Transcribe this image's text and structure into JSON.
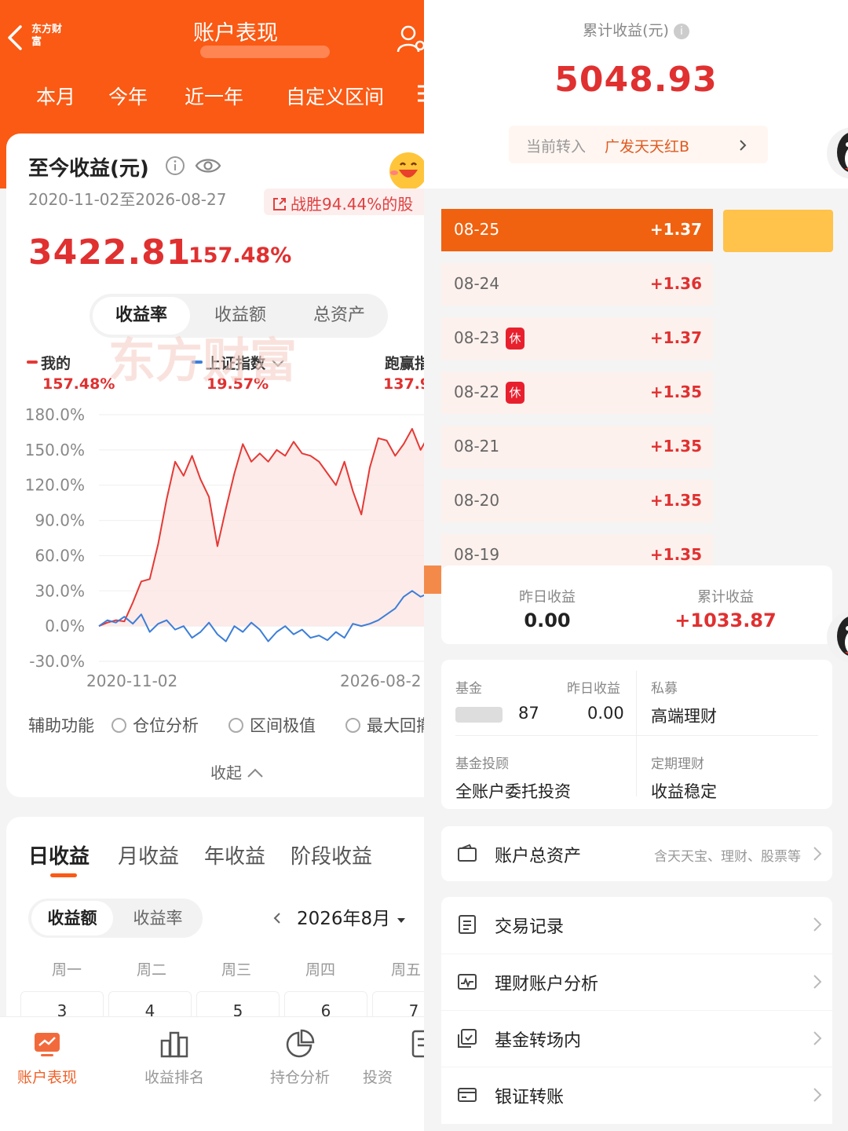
{
  "left": {
    "header": {
      "logo": "东方财富",
      "title": "账户表现",
      "periods": [
        "本月",
        "今年",
        "近一年",
        "自定义区间"
      ]
    },
    "summary": {
      "title": "至今收益(元)",
      "date_range": "2020-11-02至2026-08-27",
      "beat_text": "战胜94.44%的股",
      "profit": "3422.81",
      "rate": "157.48%"
    },
    "metric_tabs": [
      "收益率",
      "收益额",
      "总资产"
    ],
    "legend": {
      "mine_label": "我的",
      "mine_value": "157.48%",
      "index_label": "上证指数",
      "index_value": "19.57%",
      "outperform_label": "跑赢指",
      "outperform_value": "137.9"
    },
    "watermark": "东方财富",
    "aux": {
      "label": "辅助功能",
      "options": [
        "仓位分析",
        "区间极值",
        "最大回撤"
      ],
      "collapse": "收起"
    },
    "income_tabs": [
      "日收益",
      "月收益",
      "年收益",
      "阶段收益"
    ],
    "income_seg": [
      "收益额",
      "收益率"
    ],
    "month": "2026年8月",
    "weekdays": [
      "周一",
      "周二",
      "周三",
      "周四",
      "周五"
    ],
    "days": [
      "3",
      "4",
      "5",
      "6",
      "7"
    ],
    "bottom_nav": [
      "账户表现",
      "收益排名",
      "持仓分析",
      "投资"
    ]
  },
  "chart_data": {
    "type": "line",
    "title": "",
    "xlabel": "",
    "ylabel": "",
    "ylim": [
      -30,
      180
    ],
    "yticks": [
      "180.0%",
      "150.0%",
      "120.0%",
      "90.0%",
      "60.0%",
      "30.0%",
      "0.0%",
      "-30.0%"
    ],
    "xticks": [
      "2020-11-02",
      "2026-08-2"
    ],
    "colors": {
      "mine": "#e53935",
      "index": "#3d7ed8"
    },
    "series": [
      {
        "name": "我的",
        "values": [
          0,
          3,
          5,
          4,
          20,
          38,
          40,
          70,
          108,
          140,
          128,
          145,
          125,
          110,
          68,
          100,
          130,
          155,
          140,
          147,
          140,
          150,
          145,
          157,
          147,
          145,
          140,
          130,
          120,
          140,
          115,
          95,
          135,
          160,
          158,
          145,
          155,
          168,
          150,
          163,
          157,
          157
        ]
      },
      {
        "name": "上证指数",
        "values": [
          0,
          5,
          3,
          8,
          2,
          10,
          -5,
          2,
          5,
          -3,
          0,
          -10,
          -5,
          3,
          -7,
          -13,
          0,
          -5,
          3,
          -3,
          -13,
          -5,
          0,
          -7,
          -3,
          -10,
          -8,
          -12,
          -5,
          -10,
          2,
          0,
          2,
          5,
          10,
          15,
          25,
          30,
          25,
          28,
          25,
          25
        ]
      }
    ]
  },
  "right": {
    "cum_label": "累计收益(元)",
    "cum_value": "5048.93",
    "transfer_label": "当前转入",
    "transfer_fund": "广发天天红B",
    "daily": [
      {
        "date": "08-25",
        "value": "+1.37",
        "rest": ""
      },
      {
        "date": "08-24",
        "value": "+1.36",
        "rest": ""
      },
      {
        "date": "08-23",
        "value": "+1.37",
        "rest": "休"
      },
      {
        "date": "08-22",
        "value": "+1.35",
        "rest": "休"
      },
      {
        "date": "08-21",
        "value": "+1.35",
        "rest": ""
      },
      {
        "date": "08-20",
        "value": "+1.35",
        "rest": ""
      },
      {
        "date": "08-19",
        "value": "+1.35",
        "rest": ""
      }
    ],
    "summary": {
      "yesterday_label": "昨日收益",
      "yesterday_value": "0.00",
      "cum_label": "累计收益",
      "cum_value": "+1033.87"
    },
    "grid": {
      "fund_label": "基金",
      "fund_value": "87",
      "fund_yday_label": "昨日收益",
      "fund_yday_value": "0.00",
      "private_label": "私募",
      "private_value": "高端理财",
      "advisory_label": "基金投顾",
      "advisory_value": "全账户委托投资",
      "fixed_label": "定期理财",
      "fixed_value": "收益稳定"
    },
    "menu": {
      "total_assets": "账户总资产",
      "total_hint": "含天天宝、理财、股票等",
      "records": "交易记录",
      "analysis": "理财账户分析",
      "transfer_in": "基金转场内",
      "bank": "银证转账"
    }
  }
}
